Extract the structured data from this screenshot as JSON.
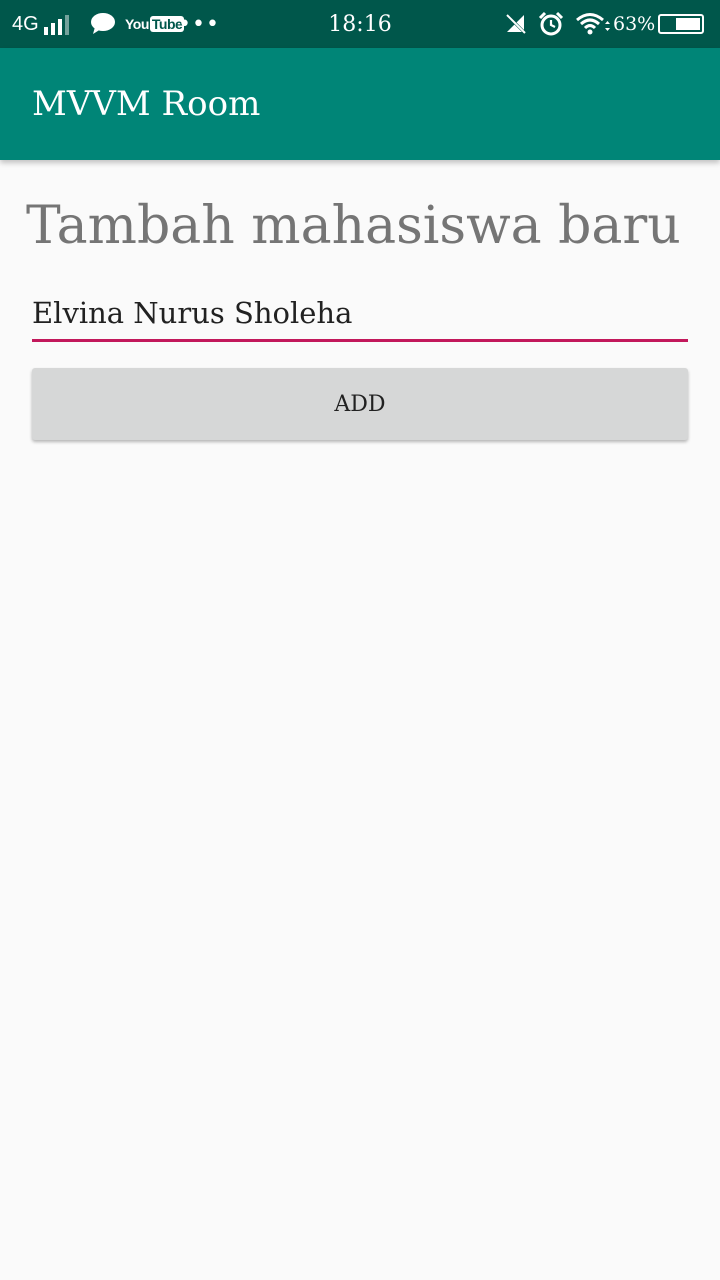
{
  "status_bar": {
    "network": "4G",
    "youtube_you": "You",
    "youtube_tube": "Tube",
    "more": "•••",
    "time": "18:16",
    "battery_percent": "63%",
    "battery_level": 0.63,
    "icons": [
      "signal-icon",
      "chat-icon",
      "youtube-icon",
      "more-icon",
      "mute-icon",
      "alarm-icon",
      "wifi-icon",
      "battery-icon"
    ]
  },
  "app_bar": {
    "title": "MVVM Room",
    "color": "#008577"
  },
  "main": {
    "heading": "Tambah mahasiswa baru",
    "name_input_value": "Elvina Nurus Sholeha",
    "add_button_label": "ADD"
  },
  "colors": {
    "status_bar": "#00574b",
    "primary": "#008577",
    "accent": "#c2185b",
    "background": "#fafafa"
  }
}
